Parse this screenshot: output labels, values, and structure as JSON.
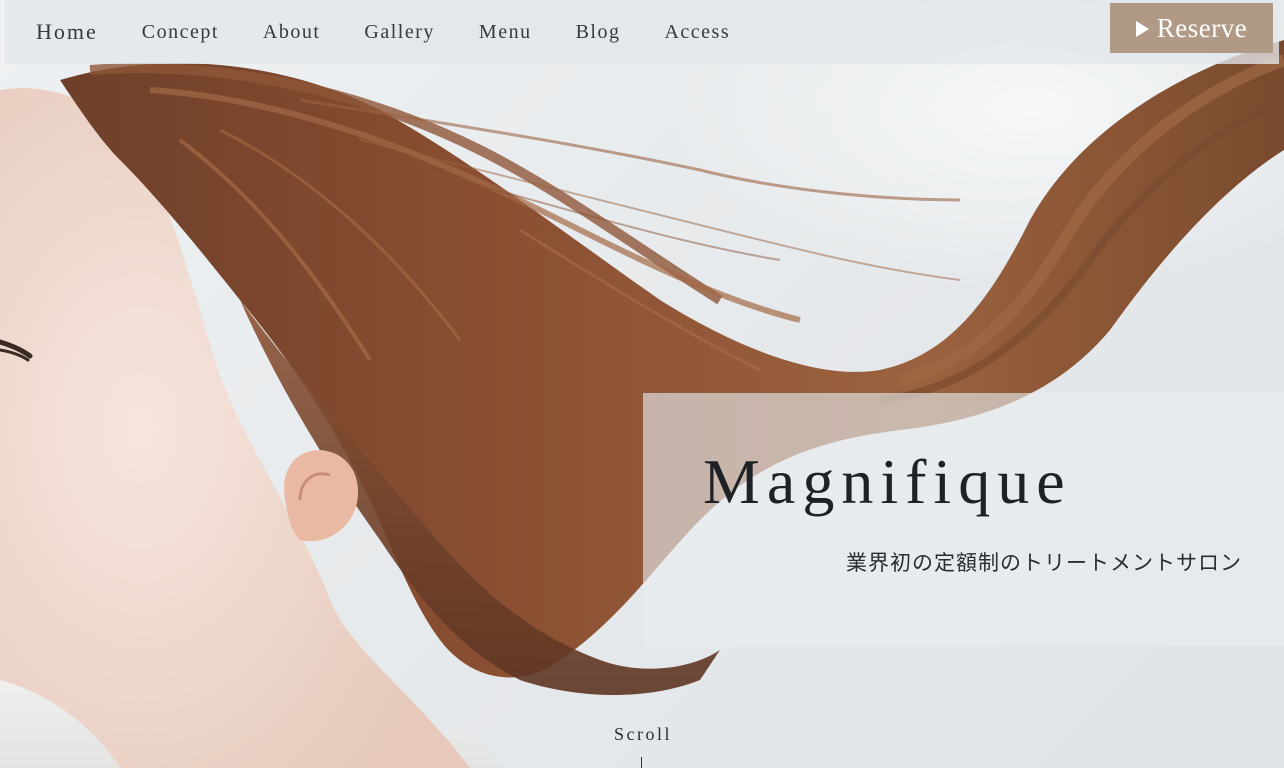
{
  "nav": {
    "items": [
      {
        "label": "Home"
      },
      {
        "label": "Concept"
      },
      {
        "label": "About"
      },
      {
        "label": "Gallery"
      },
      {
        "label": "Menu"
      },
      {
        "label": "Blog"
      },
      {
        "label": "Access"
      }
    ],
    "reserve_label": "Reserve",
    "reserve_icon": "play-icon"
  },
  "hero": {
    "title": "Magnifique",
    "tagline": "業界初の定額制のトリートメントサロン",
    "scroll_label": "Scroll"
  },
  "colors": {
    "reserve_bg": "#b09a86",
    "nav_bg": "#e2e7eb",
    "text": "#1e2226"
  }
}
